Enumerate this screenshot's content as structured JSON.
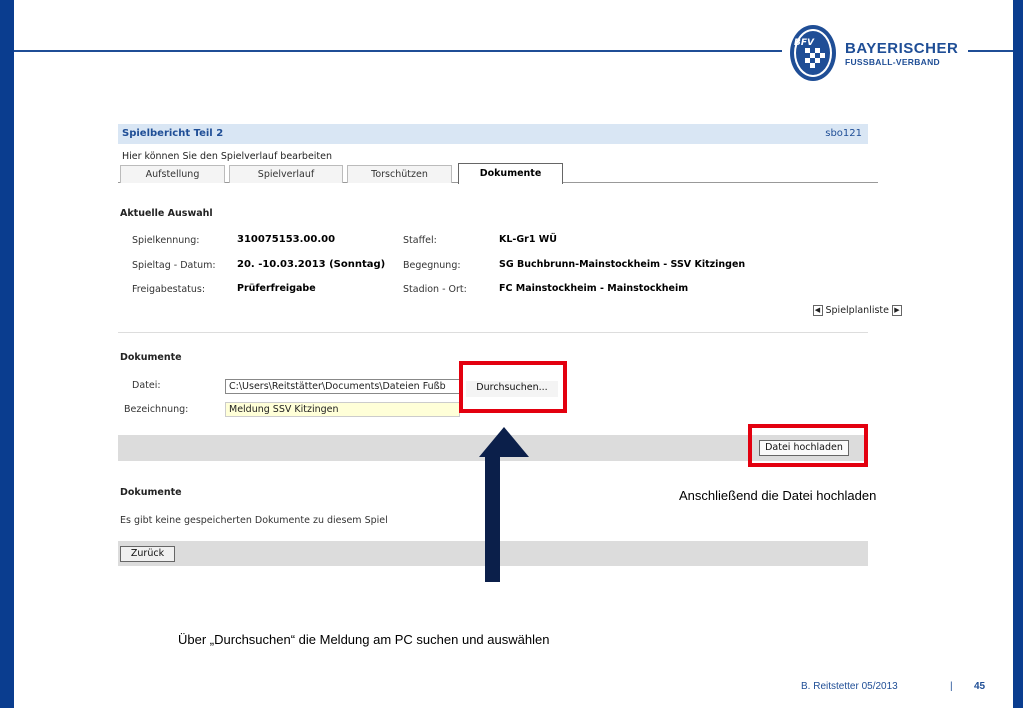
{
  "brand": {
    "line1": "BAYERISCHER",
    "line2": "FUSSBALL-VERBAND",
    "emblem": "BFV",
    "colors": {
      "primary": "#1f4e96",
      "dark": "#0a3d8f",
      "highlight": "#e3000f"
    }
  },
  "app": {
    "title": "Spielbericht Teil 2",
    "code": "sbo121",
    "hint": "Hier können Sie den Spielverlauf bearbeiten",
    "tabs": [
      {
        "label": "Aufstellung",
        "active": false
      },
      {
        "label": "Spielverlauf",
        "active": false
      },
      {
        "label": "Torschützen",
        "active": false
      },
      {
        "label": "Dokumente",
        "active": true
      }
    ]
  },
  "selection": {
    "title": "Aktuelle Auswahl",
    "id_label": "Spielkennung:",
    "id_value": "310075153.00.00",
    "date_label": "Spieltag - Datum:",
    "date_value": "20. -10.03.2013 (Sonntag)",
    "status_label": "Freigabestatus:",
    "status_value": "Prüferfreigabe",
    "staffel_label": "Staffel:",
    "staffel_value": "KL-Gr1 WÜ",
    "match_label": "Begegnung:",
    "match_value": "SG Buchbrunn-Mainstockheim - SSV Kitzingen",
    "venue_label": "Stadion - Ort:",
    "venue_value": "FC Mainstockheim - Mainstockheim",
    "nav_label": "Spielplanliste"
  },
  "upload": {
    "title": "Dokumente",
    "file_label": "Datei:",
    "file_value": "C:\\Users\\Reitstätter\\Documents\\Dateien Fußb",
    "browse_label": "Durchsuchen...",
    "name_label": "Bezeichnung:",
    "name_value": "Meldung SSV Kitzingen",
    "upload_label": "Datei hochladen"
  },
  "documents": {
    "title": "Dokumente",
    "empty_text": "Es gibt keine gespeicherten Dokumente zu diesem Spiel",
    "back_label": "Zurück"
  },
  "annotations": {
    "upload_note": "Anschließend die Datei hochladen",
    "browse_note": "Über „Durchsuchen“ die Meldung am PC suchen und auswählen"
  },
  "footer": {
    "author": "B. Reitstetter  05/2013",
    "divider": "|",
    "page": "45"
  }
}
